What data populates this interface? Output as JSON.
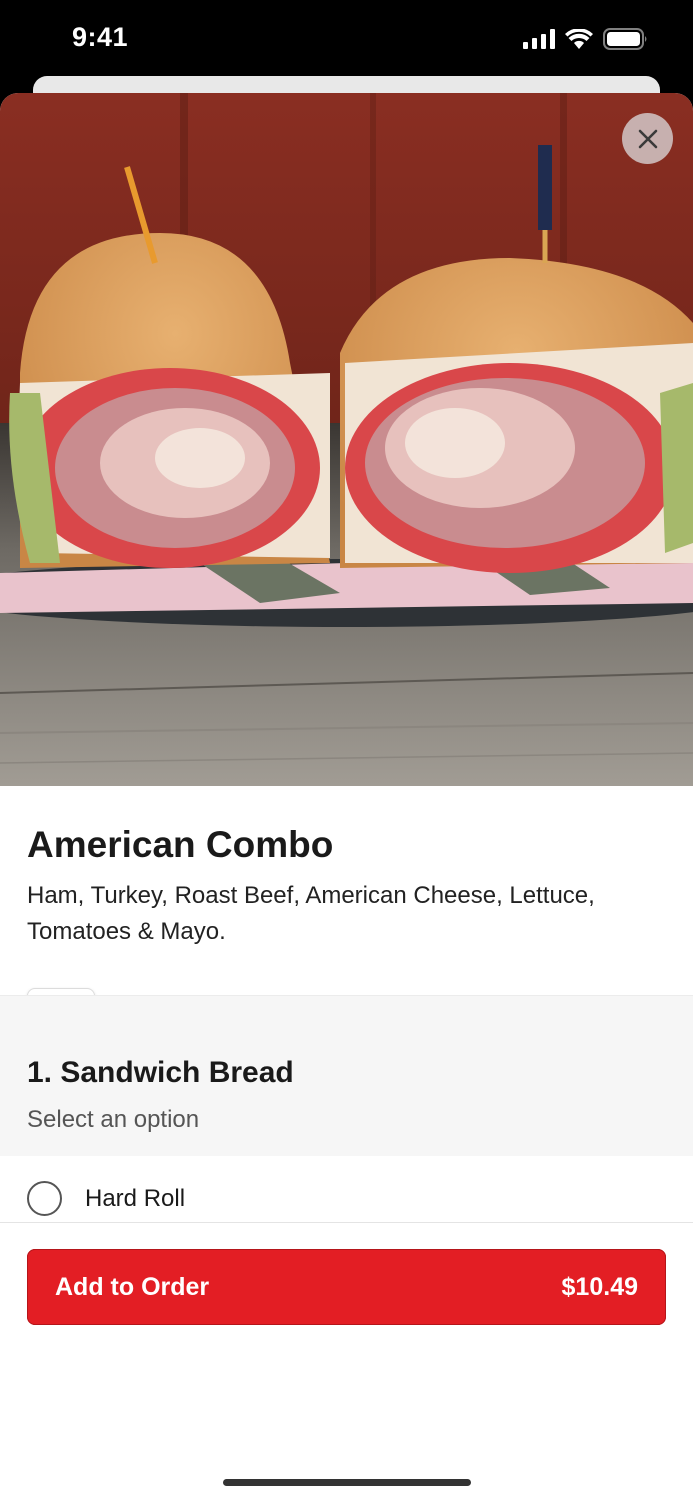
{
  "status": {
    "time": "9:41"
  },
  "product": {
    "title": "American Combo",
    "description": "Ham, Turkey, Roast Beef, American Cheese, Lettuce, Tomatoes & Mayo."
  },
  "icons": {
    "close": "close-icon",
    "favorite": "heart-icon"
  },
  "section": {
    "title": "1. Sandwich Bread",
    "subtitle": "Select an option"
  },
  "options": [
    {
      "label": "Hard Roll"
    }
  ],
  "order": {
    "add_label": "Add to Order",
    "price": "$10.49"
  },
  "colors": {
    "accent": "#e31e24"
  }
}
